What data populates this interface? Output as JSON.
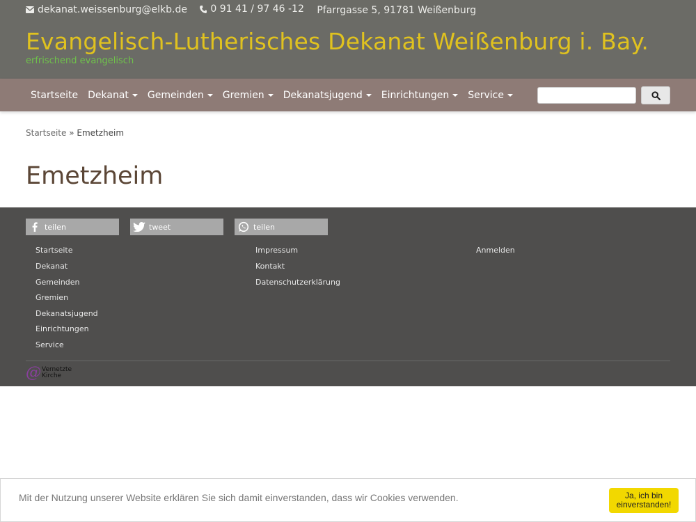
{
  "topbar": {
    "email": "dekanat.weissenburg@elkb.de",
    "phone": "0 91 41 / 97 46 -12",
    "address": "Pfarrgasse 5, 91781 Weißenburg"
  },
  "site": {
    "title": "Evangelisch-Lutherisches Dekanat Weißenburg i. Bay.",
    "tagline": "erfrischend evangelisch"
  },
  "nav": {
    "items": [
      {
        "label": "Startseite",
        "dropdown": false
      },
      {
        "label": "Dekanat",
        "dropdown": true
      },
      {
        "label": "Gemeinden",
        "dropdown": true
      },
      {
        "label": "Gremien",
        "dropdown": true
      },
      {
        "label": "Dekanatsjugend",
        "dropdown": true
      },
      {
        "label": "Einrichtungen",
        "dropdown": true
      },
      {
        "label": "Service",
        "dropdown": true
      }
    ],
    "search_value": "",
    "search_icon": "search-icon"
  },
  "breadcrumb": {
    "home": "Startseite",
    "separator": "»",
    "current": "Emetzheim"
  },
  "page": {
    "title": "Emetzheim"
  },
  "share": {
    "facebook": "teilen",
    "twitter": "tweet",
    "whatsapp": "teilen"
  },
  "footer": {
    "col1": [
      "Startseite",
      "Dekanat",
      "Gemeinden",
      "Gremien",
      "Dekanatsjugend",
      "Einrichtungen",
      "Service"
    ],
    "col2": [
      "Impressum",
      "Kontakt",
      "Datenschutzerklärung"
    ],
    "col3": [
      "Anmelden"
    ],
    "logo_line1": "Vernetzte",
    "logo_line2": "Kirche"
  },
  "cookie": {
    "text": "Mit der Nutzung unserer Website erklären Sie sich damit einverstanden, dass wir Cookies verwenden.",
    "button_line1": "Ja, ich bin",
    "button_line2": "einverstanden!"
  },
  "colors": {
    "header_bg": "#6b6b66",
    "title": "#e0c21f",
    "tagline": "#6fc24b",
    "nav_bg": "#8e7b76",
    "footer_bg": "#4f4e4d",
    "cookie_button": "#f2d800"
  }
}
